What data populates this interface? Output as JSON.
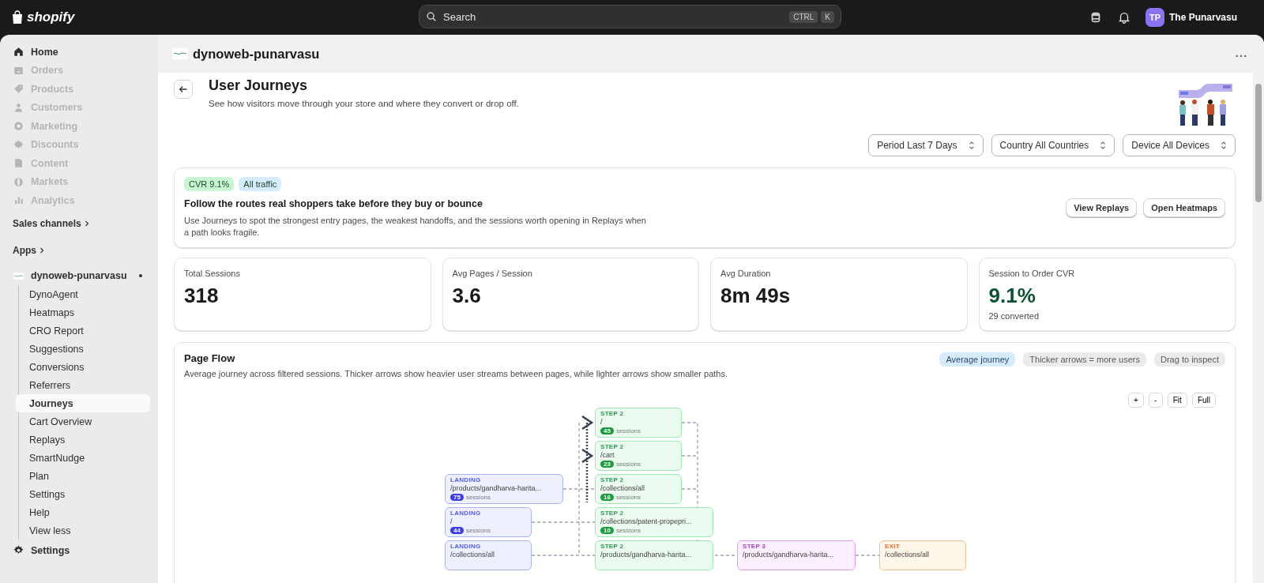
{
  "topbar": {
    "logo": "shopify",
    "search": {
      "placeholder": "Search",
      "keys": [
        "CTRL",
        "K"
      ]
    },
    "user": {
      "initials": "TP",
      "name": "The Punarvasu"
    }
  },
  "sidebar": {
    "items": [
      {
        "label": "Home",
        "disabled": false
      },
      {
        "label": "Orders",
        "disabled": true
      },
      {
        "label": "Products",
        "disabled": true
      },
      {
        "label": "Customers",
        "disabled": true
      },
      {
        "label": "Marketing",
        "disabled": true
      },
      {
        "label": "Discounts",
        "disabled": true
      },
      {
        "label": "Content",
        "disabled": true
      },
      {
        "label": "Markets",
        "disabled": true
      },
      {
        "label": "Analytics",
        "disabled": true
      }
    ],
    "sales_channels": "Sales channels",
    "apps": "Apps",
    "app": {
      "name": "dynoweb-punarvasu",
      "children": [
        {
          "label": "DynoAgent",
          "selected": false
        },
        {
          "label": "Heatmaps",
          "selected": false
        },
        {
          "label": "CRO Report",
          "selected": false
        },
        {
          "label": "Suggestions",
          "selected": false
        },
        {
          "label": "Conversions",
          "selected": false
        },
        {
          "label": "Referrers",
          "selected": false
        },
        {
          "label": "Journeys",
          "selected": true
        },
        {
          "label": "Cart Overview",
          "selected": false
        },
        {
          "label": "Replays",
          "selected": false
        },
        {
          "label": "SmartNudge",
          "selected": false
        },
        {
          "label": "Plan",
          "selected": false
        },
        {
          "label": "Settings",
          "selected": false
        },
        {
          "label": "Help",
          "selected": false
        },
        {
          "label": "View less",
          "selected": false
        }
      ]
    },
    "settings": "Settings"
  },
  "app_header": {
    "title": "dynoweb-punarvasu"
  },
  "page": {
    "title": "User Journeys",
    "subtitle": "See how visitors move through your store and where they convert or drop off."
  },
  "filters": [
    {
      "label": "Period",
      "value": "Last 7 Days"
    },
    {
      "label": "Country",
      "value": "All Countries"
    },
    {
      "label": "Device",
      "value": "All Devices"
    }
  ],
  "banner": {
    "badges": [
      {
        "text": "CVR 9.1%",
        "color": "#c9f5d2"
      },
      {
        "text": "All traffic",
        "color": "#d6ebfd"
      }
    ],
    "title": "Follow the routes real shoppers take before they buy or bounce",
    "description": "Use Journeys to spot the strongest entry pages, the weakest handoffs, and the sessions worth opening in Replays when a path looks fragile.",
    "buttons": [
      "View Replays",
      "Open Heatmaps"
    ]
  },
  "stats": [
    {
      "label": "Total Sessions",
      "value": "318",
      "kind": "plain"
    },
    {
      "label": "Avg Pages / Session",
      "value": "3.6",
      "kind": "plain"
    },
    {
      "label": "Avg Duration",
      "value": "8m 49s",
      "kind": "plain"
    },
    {
      "label": "Session to Order CVR",
      "value": "9.1%",
      "kind": "positive",
      "note": "29 converted"
    }
  ],
  "page_flow": {
    "title": "Page Flow",
    "description": "Average journey across filtered sessions. Thicker arrows show heavier user streams between pages, while lighter arrows show smaller paths.",
    "chips": [
      {
        "text": "Average journey",
        "selected": true
      },
      {
        "text": "Thicker arrows = more users",
        "selected": false
      },
      {
        "text": "Drag to inspect",
        "selected": false
      }
    ],
    "controls": [
      "+",
      "-",
      "Fit",
      "Full"
    ],
    "nodes": [
      {
        "kind": "step",
        "stage": "STEP 2",
        "path": "/",
        "count": "45",
        "unit": "sessions"
      },
      {
        "kind": "step",
        "stage": "STEP 2",
        "path": "/cart",
        "count": "23",
        "unit": "sessions"
      },
      {
        "kind": "landing",
        "stage": "LANDING",
        "path": "/products/gandharva-harita...",
        "count": "75",
        "unit": "sessions"
      },
      {
        "kind": "step",
        "stage": "STEP 2",
        "path": "/collections/all",
        "count": "16",
        "unit": "sessions"
      },
      {
        "kind": "landing",
        "stage": "LANDING",
        "path": "/",
        "count": "44",
        "unit": "sessions"
      },
      {
        "kind": "step",
        "stage": "STEP 2",
        "path": "/collections/patent-propepri...",
        "count": "10",
        "unit": "sessions"
      },
      {
        "kind": "landing",
        "stage": "LANDING",
        "path": "/collections/all"
      },
      {
        "kind": "step",
        "stage": "STEP 2",
        "path": "/products/gandharva-harita..."
      },
      {
        "kind": "step3",
        "stage": "STEP 3",
        "path": "/products/gandharva-harita..."
      },
      {
        "kind": "exit",
        "stage": "EXIT",
        "path": "/collections/all"
      }
    ]
  }
}
